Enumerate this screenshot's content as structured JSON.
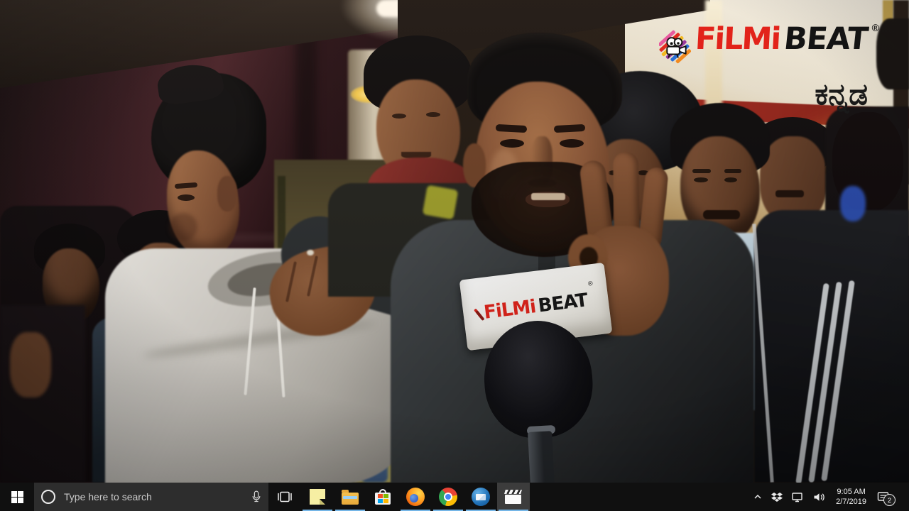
{
  "video": {
    "watermark": {
      "brand_red": "FiLMi",
      "brand_black": "BEAT",
      "registered_mark": "®",
      "language_text": "ಕನ್ನಡ",
      "colors": {
        "red": "#e2231a",
        "black": "#141414"
      }
    },
    "mic_flag": {
      "brand_red": "FiLMi",
      "brand_black": "BEAT",
      "registered_mark": "®"
    }
  },
  "taskbar": {
    "search": {
      "placeholder": "Type here to search"
    },
    "apps": [
      {
        "name": "task-view",
        "running": false,
        "active": false
      },
      {
        "name": "sticky-notes",
        "running": true,
        "active": false
      },
      {
        "name": "file-explorer",
        "running": true,
        "active": false
      },
      {
        "name": "microsoft-store",
        "running": false,
        "active": false
      },
      {
        "name": "firefox",
        "running": true,
        "active": false
      },
      {
        "name": "chrome",
        "running": true,
        "active": false
      },
      {
        "name": "thunderbird",
        "running": true,
        "active": false
      },
      {
        "name": "movies-tv",
        "running": true,
        "active": true
      }
    ],
    "tray": {
      "icons": [
        "hidden-icons-chevron",
        "dropbox",
        "network",
        "volume"
      ],
      "clock": {
        "time": "9:05 AM",
        "date": "2/7/2019"
      },
      "notification_badge": "2"
    },
    "colors": {
      "taskbar_bg": "#101010",
      "search_bg": "#2d2d2d",
      "active_app_bg": "#3c3c3c",
      "underline": "#75b6e7"
    }
  }
}
